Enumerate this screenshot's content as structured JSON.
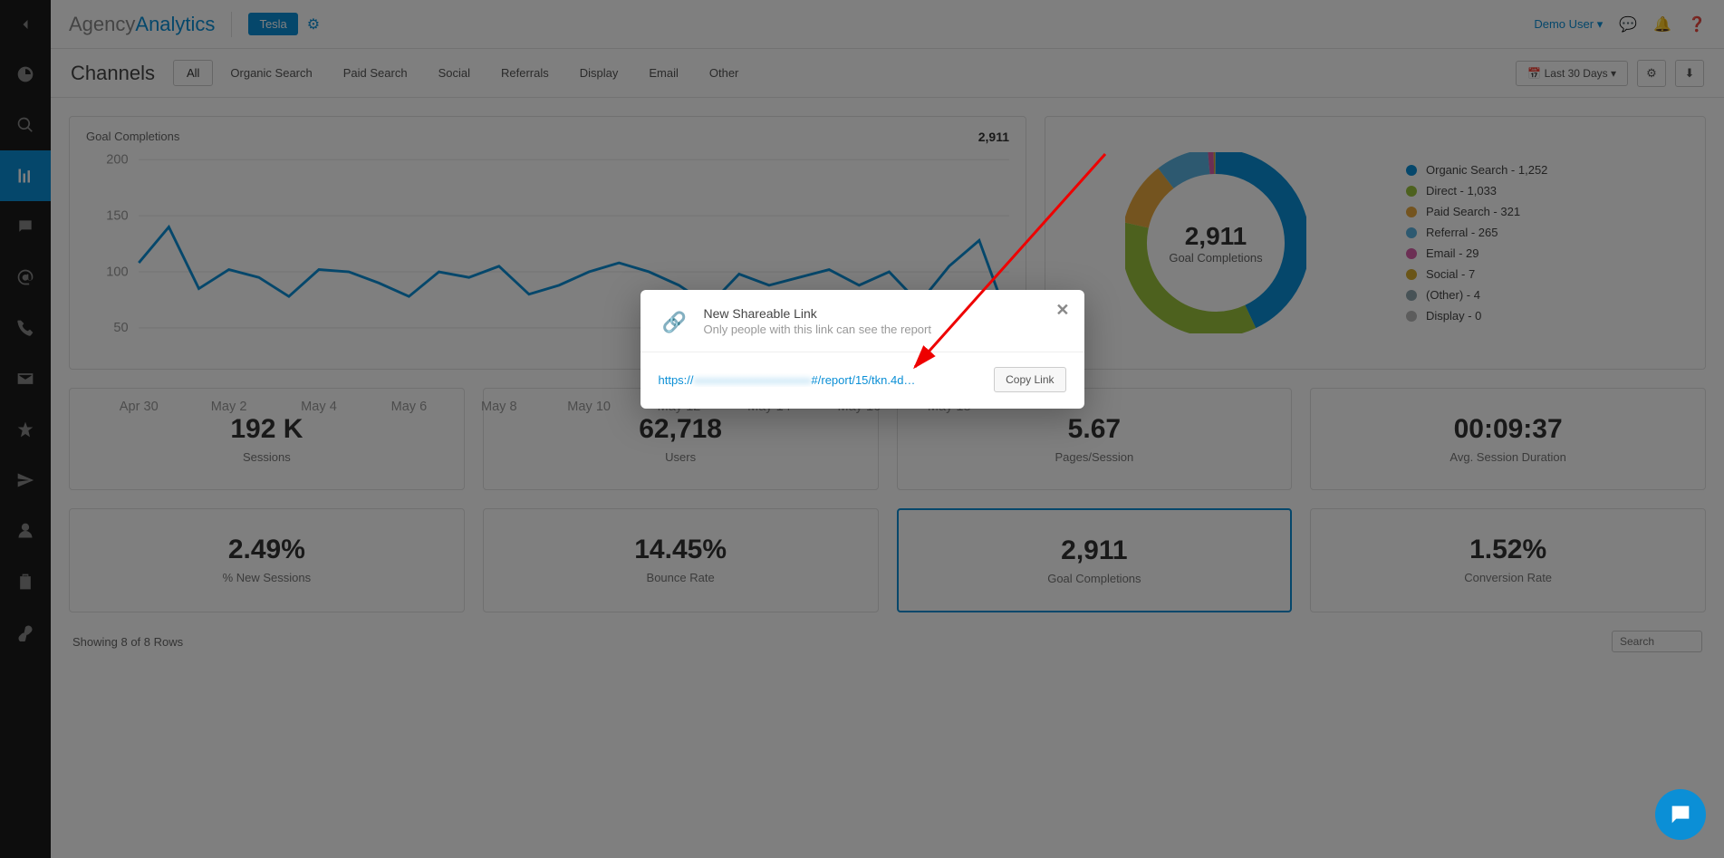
{
  "brand": {
    "part1": "Agency",
    "part2": "Analytics"
  },
  "campaign": "Tesla",
  "user": "Demo User",
  "page_title": "Channels",
  "tabs": [
    {
      "label": "All",
      "active": true
    },
    {
      "label": "Organic Search",
      "active": false
    },
    {
      "label": "Paid Search",
      "active": false
    },
    {
      "label": "Social",
      "active": false
    },
    {
      "label": "Referrals",
      "active": false
    },
    {
      "label": "Display",
      "active": false
    },
    {
      "label": "Email",
      "active": false
    },
    {
      "label": "Other",
      "active": false
    }
  ],
  "date_range": "Last 30 Days",
  "chart": {
    "title": "Goal Completions",
    "total": "2,911"
  },
  "chart_data": {
    "type": "line",
    "title": "Goal Completions",
    "ylabel": "",
    "xlabel": "",
    "ylim": [
      0,
      200
    ],
    "yticks": [
      50,
      100,
      150,
      200
    ],
    "categories": [
      "Apr 30",
      "May 2",
      "May 4",
      "May 6",
      "May 8",
      "May 10",
      "May 12",
      "May 14",
      "May 16",
      "May 18"
    ],
    "series": [
      {
        "name": "Goal Completions",
        "color": "#0b8fd6",
        "values": [
          108,
          140,
          85,
          102,
          95,
          78,
          102,
          100,
          90,
          78,
          100,
          95,
          105,
          80,
          88,
          100,
          108,
          100,
          88,
          70,
          98,
          88,
          95,
          102,
          88,
          100,
          72,
          105,
          128,
          55
        ]
      }
    ]
  },
  "donut": {
    "center_value": "2,911",
    "center_label": "Goal Completions",
    "items": [
      {
        "label": "Organic Search - 1,252",
        "color": "#0b8fd6",
        "value": 1252
      },
      {
        "label": "Direct - 1,033",
        "color": "#9ac33c",
        "value": 1033
      },
      {
        "label": "Paid Search - 321",
        "color": "#e8a93e",
        "value": 321
      },
      {
        "label": "Referral - 265",
        "color": "#5bb3e0",
        "value": 265
      },
      {
        "label": "Email - 29",
        "color": "#d85fa8",
        "value": 29
      },
      {
        "label": "Social - 7",
        "color": "#d4aa2e",
        "value": 7
      },
      {
        "label": "(Other) - 4",
        "color": "#8fa4ad",
        "value": 4
      },
      {
        "label": "Display - 0",
        "color": "#b8b8b8",
        "value": 0
      }
    ]
  },
  "stats": [
    {
      "value": "192 K",
      "label": "Sessions",
      "active": false
    },
    {
      "value": "62,718",
      "label": "Users",
      "active": false
    },
    {
      "value": "5.67",
      "label": "Pages/Session",
      "active": false
    },
    {
      "value": "00:09:37",
      "label": "Avg. Session Duration",
      "active": false
    },
    {
      "value": "2.49%",
      "label": "% New Sessions",
      "active": false
    },
    {
      "value": "14.45%",
      "label": "Bounce Rate",
      "active": false
    },
    {
      "value": "2,911",
      "label": "Goal Completions",
      "active": true
    },
    {
      "value": "1.52%",
      "label": "Conversion Rate",
      "active": false
    }
  ],
  "footer": {
    "showing": "Showing 8 of 8 Rows",
    "search_placeholder": "Search"
  },
  "modal": {
    "title": "New Shareable Link",
    "subtitle": "Only people with this link can see the report",
    "url_prefix": "https://",
    "url_suffix": "#/report/15/tkn.4d…",
    "copy_label": "Copy Link"
  }
}
